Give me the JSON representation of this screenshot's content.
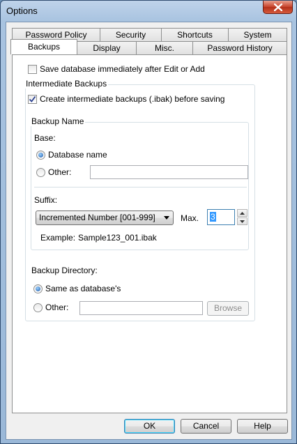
{
  "window": {
    "title": "Options"
  },
  "tabs": {
    "row1": [
      "Password Policy",
      "Security",
      "Shortcuts",
      "System"
    ],
    "row2": [
      "Backups",
      "Display",
      "Misc.",
      "Password History"
    ]
  },
  "save_immediately": {
    "label": "Save database immediately after Edit or Add",
    "checked": false
  },
  "intermediate": {
    "group_label": "Intermediate Backups",
    "create_label": "Create intermediate backups (.ibak) before saving",
    "create_checked": true
  },
  "backup_name": {
    "group_label": "Backup Name",
    "base_label": "Base:",
    "db_name_label": "Database name",
    "other_label": "Other:",
    "other_value": "",
    "suffix_label": "Suffix:",
    "suffix_selected": "Incremented Number [001-999]",
    "max_label": "Max.",
    "max_value": "3",
    "example_label": "Example:",
    "example_value": "Sample123_001.ibak"
  },
  "backup_dir": {
    "label": "Backup Directory:",
    "same_label": "Same as database's",
    "other_label": "Other:",
    "other_value": "",
    "browse_label": "Browse"
  },
  "buttons": {
    "ok": "OK",
    "cancel": "Cancel",
    "help": "Help"
  }
}
